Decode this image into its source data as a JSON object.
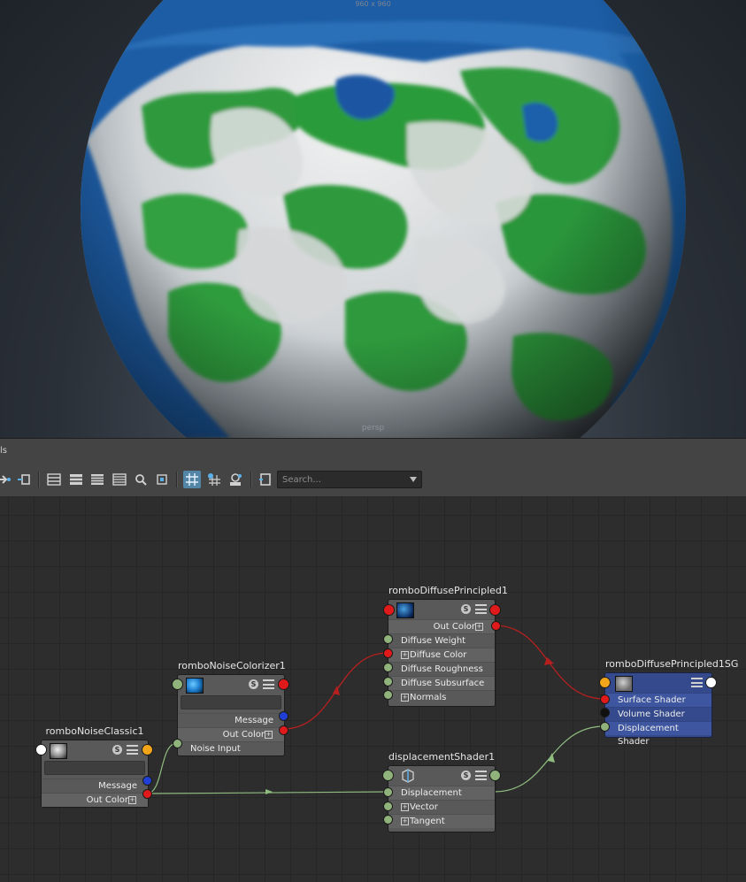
{
  "viewport": {
    "resolution": "960 x 960",
    "camera": "persp"
  },
  "panel": {
    "title": "ls"
  },
  "toolbar": {
    "search_placeholder": "Search..."
  },
  "nodes": {
    "diffuse": {
      "title": "romboDiffusePrincipled1",
      "out": "Out Color",
      "inputs": [
        "Diffuse Weight",
        "Diffuse Color",
        "Diffuse Roughness",
        "Diffuse Subsurface",
        "Normals"
      ]
    },
    "sg": {
      "title": "romboDiffusePrincipled1SG",
      "inputs": [
        "Surface Shader",
        "Volume Shader",
        "Displacement Shader"
      ]
    },
    "colorizer": {
      "title": "romboNoiseColorizer1",
      "message": "Message",
      "out": "Out Color",
      "input": "Noise Input"
    },
    "noise": {
      "title": "romboNoiseClassic1",
      "message": "Message",
      "out": "Out Color"
    },
    "displacement": {
      "title": "displacementShader1",
      "inputs": [
        "Displacement",
        "Vector Displacement",
        "Tangent"
      ]
    }
  },
  "colors": {
    "color_port": "#e01a1a",
    "message_port": "#1f3fd6",
    "float_port": "#8fb37a",
    "shader_port": "#f2a51a",
    "wire_red": "#b5201f",
    "wire_green": "#8fbd7f",
    "sg_node": "#344a8c"
  }
}
